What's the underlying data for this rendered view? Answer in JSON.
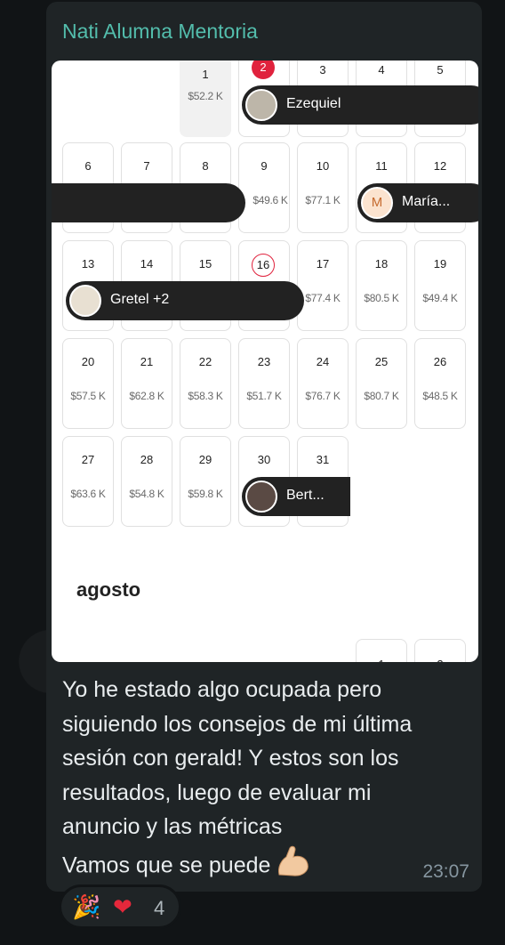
{
  "chat": {
    "sender": "Nati Alumna Mentoria",
    "message_lines": [
      "Yo he estado algo ocupada pero",
      "siguiendo los consejos de mi última",
      "sesión con gerald! Y estos son los",
      "resultados, luego de evaluar mi",
      "anuncio y las métricas",
      "Vamos que se puede"
    ],
    "time": "23:07",
    "reactions": {
      "emoji1": "🎉",
      "emoji2": "❤",
      "count": "4"
    }
  },
  "calendar": {
    "row0": [
      {
        "day": "1",
        "price": "$52.2 K"
      },
      {
        "day": "2",
        "price": ""
      },
      {
        "day": "3",
        "price": ""
      },
      {
        "day": "4",
        "price": ""
      },
      {
        "day": "5",
        "price": ""
      }
    ],
    "row1": [
      {
        "day": "6",
        "price": ""
      },
      {
        "day": "7",
        "price": ""
      },
      {
        "day": "8",
        "price": ""
      },
      {
        "day": "9",
        "price": "$49.6 K"
      },
      {
        "day": "10",
        "price": "$77.1 K"
      },
      {
        "day": "11",
        "price": ""
      },
      {
        "day": "12",
        "price": ""
      }
    ],
    "row2": [
      {
        "day": "13",
        "price": ""
      },
      {
        "day": "14",
        "price": ""
      },
      {
        "day": "15",
        "price": ""
      },
      {
        "day": "16",
        "price": ""
      },
      {
        "day": "17",
        "price": "$77.4 K"
      },
      {
        "day": "18",
        "price": "$80.5 K"
      },
      {
        "day": "19",
        "price": "$49.4 K"
      }
    ],
    "row3": [
      {
        "day": "20",
        "price": "$57.5 K"
      },
      {
        "day": "21",
        "price": "$62.8 K"
      },
      {
        "day": "22",
        "price": "$58.3 K"
      },
      {
        "day": "23",
        "price": "$51.7 K"
      },
      {
        "day": "24",
        "price": "$76.7 K"
      },
      {
        "day": "25",
        "price": "$80.7 K"
      },
      {
        "day": "26",
        "price": "$48.5 K"
      }
    ],
    "row4": [
      {
        "day": "27",
        "price": "$63.6 K"
      },
      {
        "day": "28",
        "price": "$54.8 K"
      },
      {
        "day": "29",
        "price": "$59.8 K"
      },
      {
        "day": "30",
        "price": ""
      },
      {
        "day": "31",
        "price": ""
      }
    ],
    "reservations": {
      "ezequiel": "Ezequiel",
      "maria": "María...",
      "maria_initial": "M",
      "gretel": "Gretel +2",
      "bert": "Bert..."
    },
    "next_month": "agosto",
    "next_row": [
      "1",
      "2"
    ]
  },
  "colors": {
    "accent_green": "#53bdac",
    "airbnb_red": "#e0223d",
    "bubble": "#1f2426"
  }
}
